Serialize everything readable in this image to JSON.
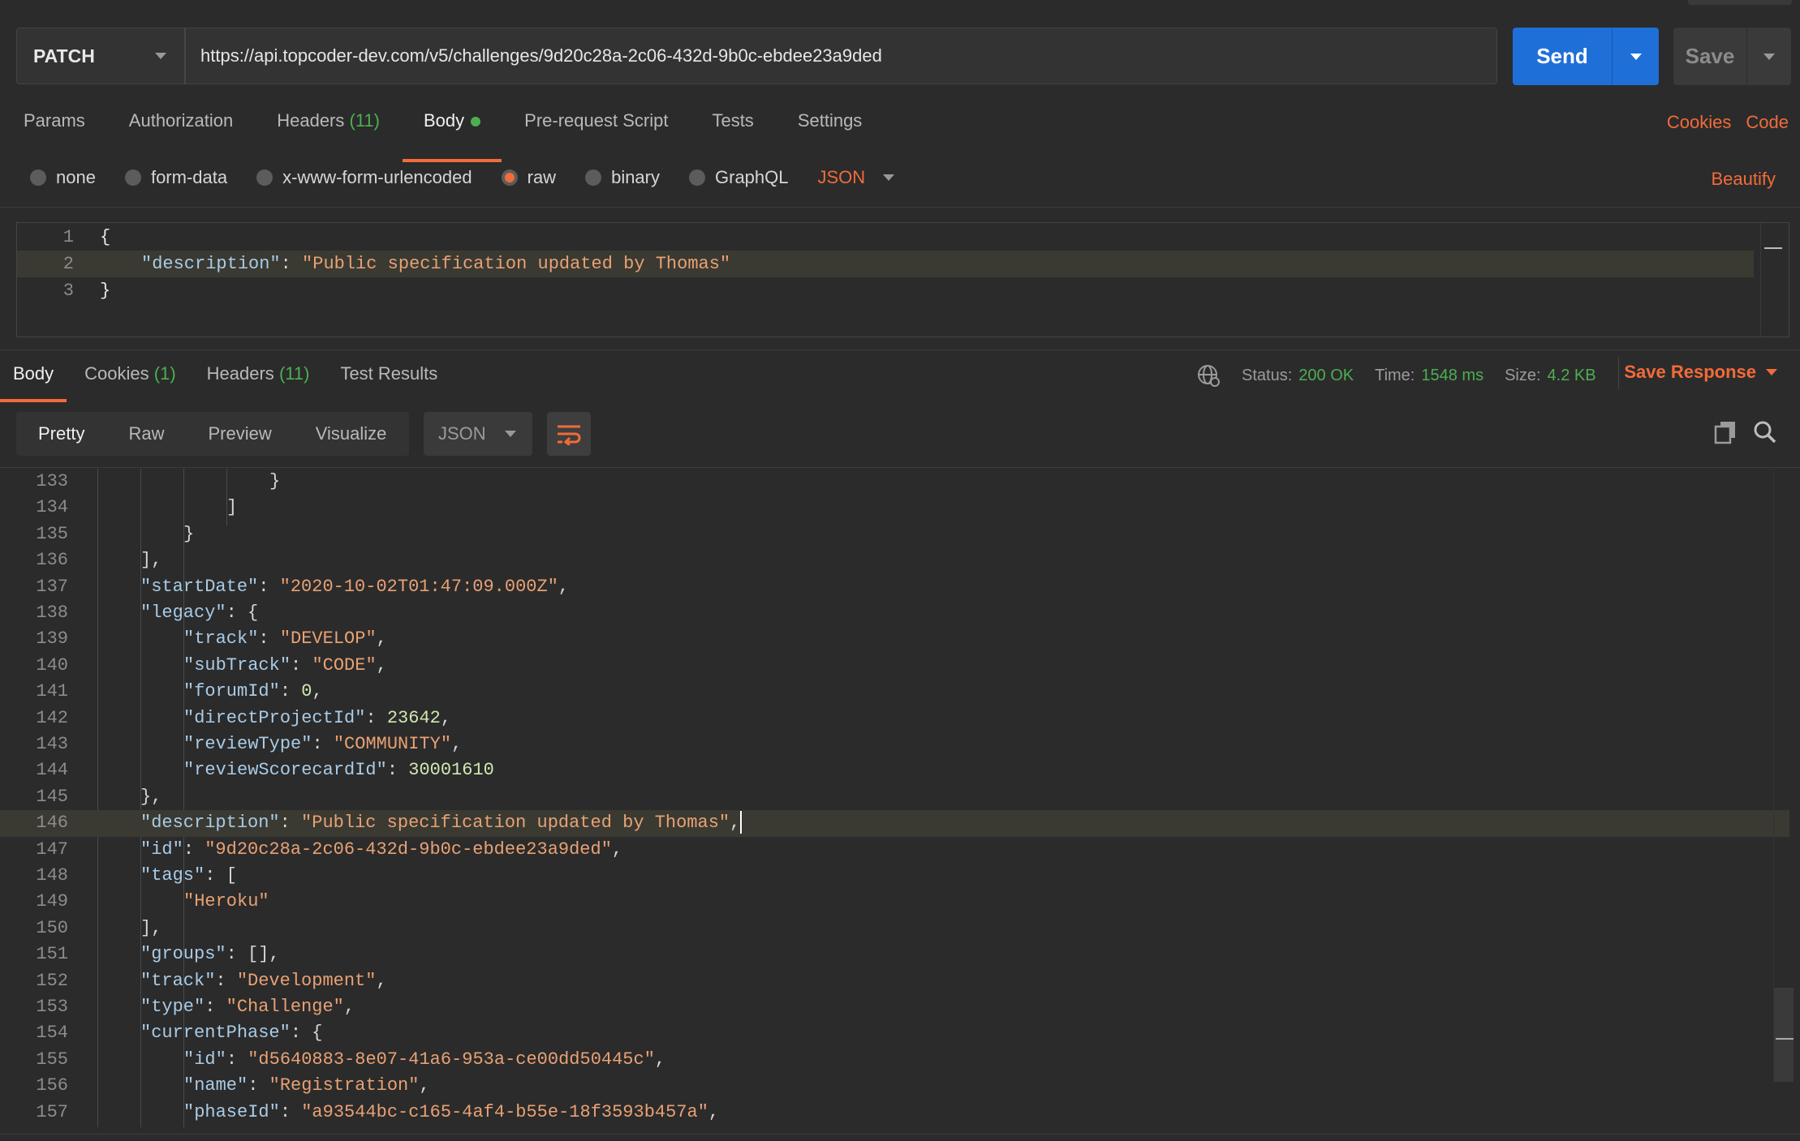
{
  "request": {
    "method": "PATCH",
    "url": "https://api.topcoder-dev.com/v5/challenges/9d20c28a-2c06-432d-9b0c-ebdee23a9ded",
    "send_label": "Send",
    "save_label": "Save"
  },
  "request_tabs": {
    "params": "Params",
    "authorization": "Authorization",
    "headers": "Headers",
    "headers_count": "(11)",
    "body": "Body",
    "prerequest": "Pre-request Script",
    "tests": "Tests",
    "settings": "Settings",
    "cookies_link": "Cookies",
    "code_link": "Code"
  },
  "body_types": {
    "none": "none",
    "form_data": "form-data",
    "urlencoded": "x-www-form-urlencoded",
    "raw": "raw",
    "binary": "binary",
    "graphql": "GraphQL",
    "language": "JSON",
    "beautify": "Beautify",
    "selected": "raw"
  },
  "request_body": {
    "ln1": "1",
    "ln2": "2",
    "ln3": "3",
    "open": "{",
    "key": "\"description\"",
    "colon": ": ",
    "value": "\"Public specification updated by Thomas\"",
    "close": "}"
  },
  "response_tabs": {
    "body": "Body",
    "cookies": "Cookies",
    "cookies_count": "(1)",
    "headers": "Headers",
    "headers_count": "(11)",
    "test_results": "Test Results"
  },
  "response_meta": {
    "status_label": "Status:",
    "status_value": "200 OK",
    "time_label": "Time:",
    "time_value": "1548 ms",
    "size_label": "Size:",
    "size_value": "4.2 KB",
    "save_response": "Save Response"
  },
  "view_modes": {
    "pretty": "Pretty",
    "raw": "Raw",
    "preview": "Preview",
    "visualize": "Visualize",
    "format": "JSON"
  },
  "response_lines": [
    {
      "n": "133",
      "i": 4,
      "segs": [
        [
          "p",
          "}"
        ]
      ]
    },
    {
      "n": "134",
      "i": 3,
      "segs": [
        [
          "p",
          "]"
        ]
      ]
    },
    {
      "n": "135",
      "i": 2,
      "segs": [
        [
          "p",
          "}"
        ]
      ]
    },
    {
      "n": "136",
      "i": 1,
      "segs": [
        [
          "p",
          "],"
        ]
      ]
    },
    {
      "n": "137",
      "i": 1,
      "segs": [
        [
          "k",
          "\"startDate\""
        ],
        [
          "p",
          ": "
        ],
        [
          "s",
          "\"2020-10-02T01:47:09.000Z\""
        ],
        [
          "p",
          ","
        ]
      ]
    },
    {
      "n": "138",
      "i": 1,
      "segs": [
        [
          "k",
          "\"legacy\""
        ],
        [
          "p",
          ": {"
        ]
      ]
    },
    {
      "n": "139",
      "i": 2,
      "segs": [
        [
          "k",
          "\"track\""
        ],
        [
          "p",
          ": "
        ],
        [
          "s",
          "\"DEVELOP\""
        ],
        [
          "p",
          ","
        ]
      ]
    },
    {
      "n": "140",
      "i": 2,
      "segs": [
        [
          "k",
          "\"subTrack\""
        ],
        [
          "p",
          ": "
        ],
        [
          "s",
          "\"CODE\""
        ],
        [
          "p",
          ","
        ]
      ]
    },
    {
      "n": "141",
      "i": 2,
      "segs": [
        [
          "k",
          "\"forumId\""
        ],
        [
          "p",
          ": "
        ],
        [
          "n",
          "0"
        ],
        [
          "p",
          ","
        ]
      ]
    },
    {
      "n": "142",
      "i": 2,
      "segs": [
        [
          "k",
          "\"directProjectId\""
        ],
        [
          "p",
          ": "
        ],
        [
          "n",
          "23642"
        ],
        [
          "p",
          ","
        ]
      ]
    },
    {
      "n": "143",
      "i": 2,
      "segs": [
        [
          "k",
          "\"reviewType\""
        ],
        [
          "p",
          ": "
        ],
        [
          "s",
          "\"COMMUNITY\""
        ],
        [
          "p",
          ","
        ]
      ]
    },
    {
      "n": "144",
      "i": 2,
      "segs": [
        [
          "k",
          "\"reviewScorecardId\""
        ],
        [
          "p",
          ": "
        ],
        [
          "n",
          "30001610"
        ]
      ]
    },
    {
      "n": "145",
      "i": 1,
      "segs": [
        [
          "p",
          "},"
        ]
      ]
    },
    {
      "n": "146",
      "i": 1,
      "hl": true,
      "segs": [
        [
          "k",
          "\"description\""
        ],
        [
          "p",
          ": "
        ],
        [
          "s",
          "\"Public specification updated by Thomas\""
        ],
        [
          "p",
          ","
        ]
      ]
    },
    {
      "n": "147",
      "i": 1,
      "segs": [
        [
          "k",
          "\"id\""
        ],
        [
          "p",
          ": "
        ],
        [
          "s",
          "\"9d20c28a-2c06-432d-9b0c-ebdee23a9ded\""
        ],
        [
          "p",
          ","
        ]
      ]
    },
    {
      "n": "148",
      "i": 1,
      "segs": [
        [
          "k",
          "\"tags\""
        ],
        [
          "p",
          ": ["
        ]
      ]
    },
    {
      "n": "149",
      "i": 2,
      "segs": [
        [
          "s",
          "\"Heroku\""
        ]
      ]
    },
    {
      "n": "150",
      "i": 1,
      "segs": [
        [
          "p",
          "],"
        ]
      ]
    },
    {
      "n": "151",
      "i": 1,
      "segs": [
        [
          "k",
          "\"groups\""
        ],
        [
          "p",
          ": [],"
        ]
      ]
    },
    {
      "n": "152",
      "i": 1,
      "segs": [
        [
          "k",
          "\"track\""
        ],
        [
          "p",
          ": "
        ],
        [
          "s",
          "\"Development\""
        ],
        [
          "p",
          ","
        ]
      ]
    },
    {
      "n": "153",
      "i": 1,
      "segs": [
        [
          "k",
          "\"type\""
        ],
        [
          "p",
          ": "
        ],
        [
          "s",
          "\"Challenge\""
        ],
        [
          "p",
          ","
        ]
      ]
    },
    {
      "n": "154",
      "i": 1,
      "segs": [
        [
          "k",
          "\"currentPhase\""
        ],
        [
          "p",
          ": {"
        ]
      ]
    },
    {
      "n": "155",
      "i": 2,
      "segs": [
        [
          "k",
          "\"id\""
        ],
        [
          "p",
          ": "
        ],
        [
          "s",
          "\"d5640883-8e07-41a6-953a-ce00dd50445c\""
        ],
        [
          "p",
          ","
        ]
      ]
    },
    {
      "n": "156",
      "i": 2,
      "segs": [
        [
          "k",
          "\"name\""
        ],
        [
          "p",
          ": "
        ],
        [
          "s",
          "\"Registration\""
        ],
        [
          "p",
          ","
        ]
      ]
    },
    {
      "n": "157",
      "i": 2,
      "segs": [
        [
          "k",
          "\"phaseId\""
        ],
        [
          "p",
          ": "
        ],
        [
          "s",
          "\"a93544bc-c165-4af4-b55e-18f3593b457a\""
        ],
        [
          "p",
          ","
        ]
      ]
    }
  ],
  "colors": {
    "accent": "#f26b3a",
    "send_blue": "#1f6fd8",
    "status_green": "#4caf50",
    "background": "#2b2b2b"
  },
  "icons": [
    "chevron-down-icon",
    "globe-icon",
    "wrap-lines-icon",
    "copy-icon",
    "search-icon"
  ]
}
